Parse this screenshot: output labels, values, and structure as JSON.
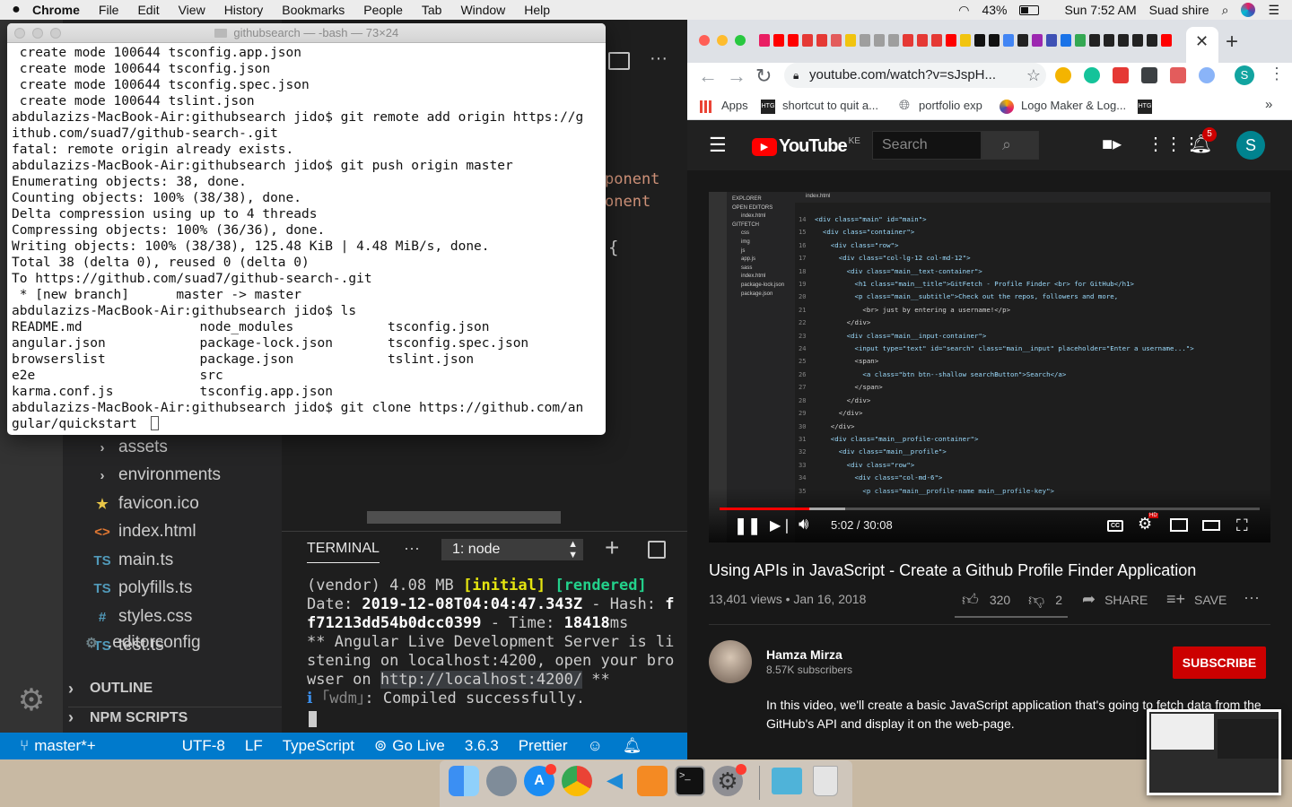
{
  "menubar": {
    "app": "Chrome",
    "items": [
      "File",
      "Edit",
      "View",
      "History",
      "Bookmarks",
      "People",
      "Tab",
      "Window",
      "Help"
    ],
    "battery": "43%",
    "clock": "Sun 7:52 AM",
    "user": "Suad shire"
  },
  "terminal": {
    "title": "githubsearch — -bash — 73×24",
    "lines": [
      " create mode 100644 tsconfig.app.json",
      " create mode 100644 tsconfig.json",
      " create mode 100644 tsconfig.spec.json",
      " create mode 100644 tslint.json",
      "abdulazizs-MacBook-Air:githubsearch jido$ git remote add origin https://g",
      "ithub.com/suad7/github-search-.git",
      "fatal: remote origin already exists.",
      "abdulazizs-MacBook-Air:githubsearch jido$ git push origin master",
      "Enumerating objects: 38, done.",
      "Counting objects: 100% (38/38), done.",
      "Delta compression using up to 4 threads",
      "Compressing objects: 100% (36/36), done.",
      "Writing objects: 100% (38/38), 125.48 KiB | 4.48 MiB/s, done.",
      "Total 38 (delta 0), reused 0 (delta 0)",
      "To https://github.com/suad7/github-search-.git",
      " * [new branch]      master -> master",
      "abdulazizs-MacBook-Air:githubsearch jido$ ls",
      "README.md               node_modules            tsconfig.json",
      "angular.json            package-lock.json       tsconfig.spec.json",
      "browserslist            package.json            tslint.json",
      "e2e                     src",
      "karma.conf.js           tsconfig.app.json",
      "abdulazizs-MacBook-Air:githubsearch jido$ git clone https://github.com/an",
      "gular/quickstart "
    ]
  },
  "vscode": {
    "editor_fragments": [
      "ponent",
      "onent",
      "{"
    ],
    "tree": [
      {
        "label": "assets",
        "icon": "chevron-right-icon",
        "glyph": "›",
        "color": "#c5c5c5"
      },
      {
        "label": "environments",
        "icon": "chevron-right-icon",
        "glyph": "›",
        "color": "#c5c5c5"
      },
      {
        "label": "favicon.ico",
        "icon": "star-icon",
        "glyph": "★",
        "color": "#e8c547"
      },
      {
        "label": "index.html",
        "icon": "html-icon",
        "glyph": "<>",
        "color": "#e37933"
      },
      {
        "label": "main.ts",
        "icon": "typescript-icon",
        "glyph": "TS",
        "color": "#519aba"
      },
      {
        "label": "polyfills.ts",
        "icon": "typescript-icon",
        "glyph": "TS",
        "color": "#519aba"
      },
      {
        "label": "styles.css",
        "icon": "css-icon",
        "glyph": "#",
        "color": "#519aba"
      },
      {
        "label": "test.ts",
        "icon": "typescript-icon",
        "glyph": "TS",
        "color": "#519aba"
      },
      {
        "label": ".editorconfig",
        "icon": "gear-icon",
        "glyph": "⚙",
        "color": "#6d8086"
      }
    ],
    "outline": "OUTLINE",
    "npm_scripts": "NPM SCRIPTS",
    "panel": {
      "tab": "TERMINAL",
      "more": "···",
      "select": "1: node",
      "lines": [
        {
          "parts": [
            [
              "(vendor) 4.08 MB ",
              "#cccccc",
              false
            ],
            [
              "[initial]",
              "#e5e510",
              true
            ],
            [
              " ",
              "#cccccc",
              false
            ],
            [
              "[rendered]",
              "#23d18b",
              true
            ]
          ]
        },
        {
          "parts": [
            [
              "Date: ",
              "#cccccc",
              false
            ],
            [
              "2019-12-08T04:04:47.343Z",
              "#ffffff",
              true
            ],
            [
              " - Hash: ",
              "#cccccc",
              false
            ],
            [
              "f",
              "#ffffff",
              true
            ]
          ]
        },
        {
          "parts": [
            [
              "f71213dd54b0dcc0399",
              "#ffffff",
              true
            ],
            [
              " - Time: ",
              "#cccccc",
              false
            ],
            [
              "18418",
              "#ffffff",
              true
            ],
            [
              "ms",
              "#cccccc",
              false
            ]
          ]
        },
        {
          "parts": [
            [
              "** Angular Live Development Server is li",
              "#cccccc",
              false
            ]
          ]
        },
        {
          "parts": [
            [
              "stening on localhost:4200, open your bro",
              "#cccccc",
              false
            ]
          ]
        },
        {
          "parts": [
            [
              "wser on ",
              "#cccccc",
              false
            ],
            [
              "http://localhost:4200/",
              "#cccccc",
              false
            ],
            [
              " **",
              "#cccccc",
              false
            ]
          ]
        },
        {
          "parts": [
            [
              "ℹ ",
              "#3b8eea",
              false
            ],
            [
              "｢wdm｣",
              "#888888",
              false
            ],
            [
              ": Compiled successfully.",
              "#cccccc",
              false
            ]
          ]
        }
      ]
    },
    "status": {
      "branch": "master*+",
      "encoding": "UTF-8",
      "eol": "LF",
      "language": "TypeScript",
      "golive": "Go Live",
      "version": "3.6.3",
      "formatter": "Prettier"
    }
  },
  "chrome": {
    "url": "youtube.com/watch?v=sJspH...",
    "bookmarks": [
      "Apps",
      "shortcut to quit a...",
      "portfolio exp",
      "Logo Maker & Log..."
    ],
    "profile_initial": "S"
  },
  "youtube": {
    "logo": "YouTube",
    "region": "KE",
    "search_placeholder": "Search",
    "notifications": "5",
    "avatar": "S",
    "time": "5:02 / 30:08",
    "progress": 0.167,
    "title": "Using APIs in JavaScript - Create a Github Profile Finder Application",
    "views": "13,401 views • Jan 16, 2018",
    "likes": "320",
    "dislikes": "2",
    "share": "SHARE",
    "save": "SAVE",
    "channel": "Hamza Mirza",
    "subscribers": "8.57K subscribers",
    "subscribe": "SUBSCRIBE",
    "description": "In this video, we'll create a basic JavaScript application that's going to fetch data from the GitHub's API and display it on the web-page.",
    "code_lines": [
      "<div class=\"main\" id=\"main\">",
      "  <div class=\"container\">",
      "    <div class=\"row\">",
      "      <div class=\"col-lg-12 col-md-12\">",
      "        <div class=\"main__text-container\">",
      "          <h1 class=\"main__title\">GitFetch - Profile Finder <br> for GitHub</h1>",
      "          <p class=\"main__subtitle\">Check out the repos, followers and more,",
      "            <br> just by entering a username!</p>",
      "        </div>",
      "        <div class=\"main__input-container\">",
      "          <input type=\"text\" id=\"search\" class=\"main__input\" placeholder=\"Enter a username...\">",
      "          <span>",
      "            <a class=\"btn btn--shallow searchButton\">Search</a>",
      "          </span>",
      "        </div>",
      "      </div>",
      "    </div>",
      "    <div class=\"main__profile-container\">",
      "      <div class=\"main__profile\">",
      "        <div class=\"row\">",
      "          <div class=\"col-md-6\">",
      "            <p class=\"main__profile-name main__profile-key\">"
    ],
    "explorer_items": [
      "EXPLORER",
      "OPEN EDITORS",
      "index.html",
      "GITFETCH",
      "css",
      "img",
      "js",
      "app.js",
      "sass",
      "index.html",
      "package-lock.json",
      "package.json"
    ]
  }
}
